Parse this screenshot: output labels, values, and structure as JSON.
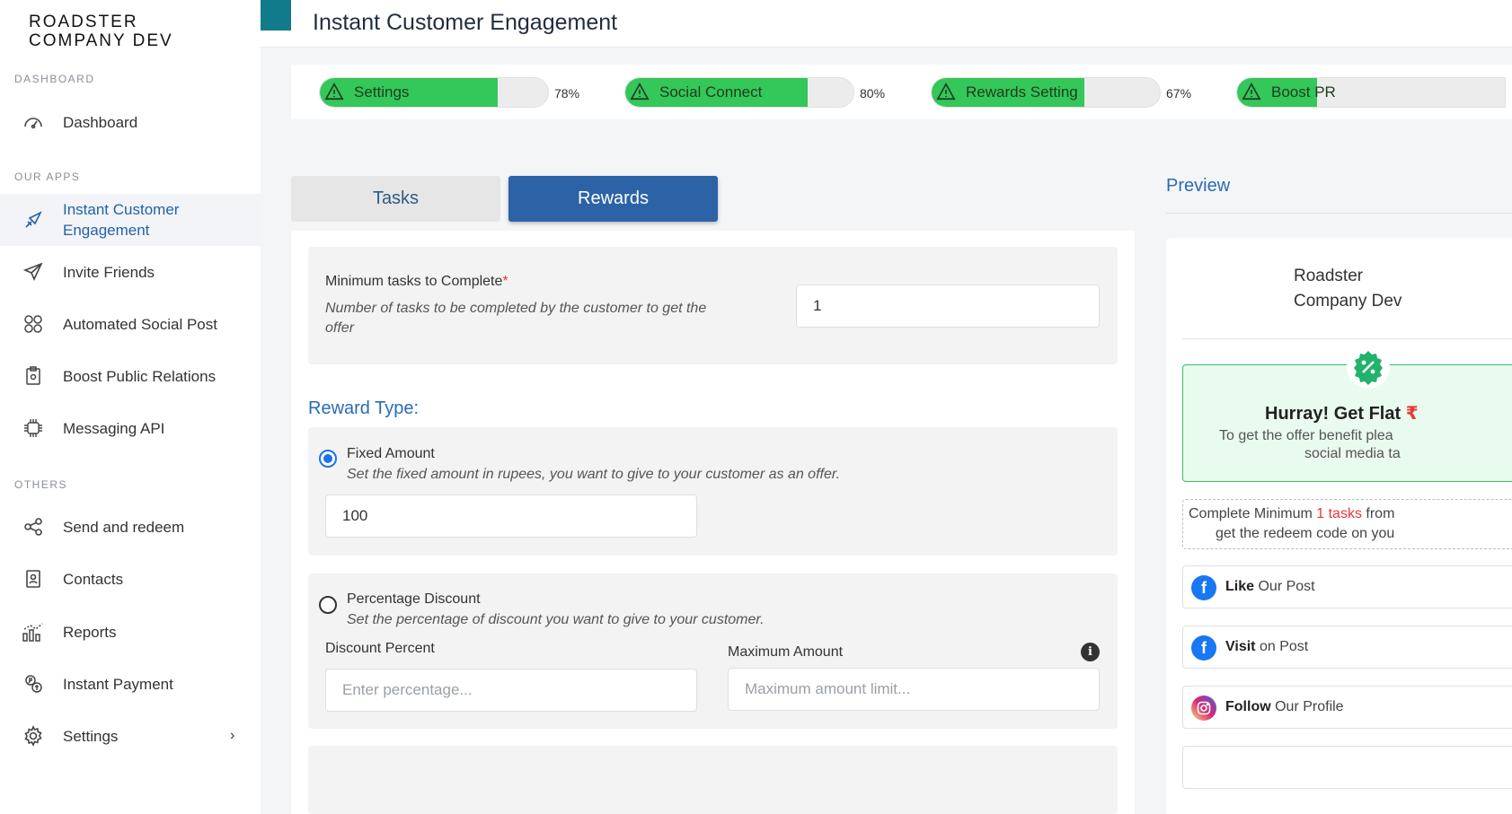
{
  "brand": {
    "line1": "ROADSTER",
    "line2": "COMPANY DEV"
  },
  "sidebar": {
    "sections": {
      "dashboard": "DASHBOARD",
      "apps": "OUR APPS",
      "others": "OTHERS"
    },
    "items": [
      {
        "label": "Dashboard",
        "icon": "gauge-icon"
      },
      {
        "label": "Instant Customer Engagement",
        "icon": "megaphone-icon",
        "active": true
      },
      {
        "label": "Invite Friends",
        "icon": "paper-plane-icon"
      },
      {
        "label": "Automated Social Post",
        "icon": "social-grid-icon"
      },
      {
        "label": "Boost Public Relations",
        "icon": "clipboard-icon"
      },
      {
        "label": "Messaging API",
        "icon": "api-chip-icon"
      },
      {
        "label": "Send and redeem",
        "icon": "share-icon"
      },
      {
        "label": "Contacts",
        "icon": "contact-book-icon"
      },
      {
        "label": "Reports",
        "icon": "bar-chart-icon"
      },
      {
        "label": "Instant Payment",
        "icon": "payment-icon"
      },
      {
        "label": "Settings",
        "icon": "gear-icon"
      }
    ]
  },
  "header": {
    "title": "Instant Customer Engagement"
  },
  "progress": [
    {
      "label": "Settings",
      "percent_text": "78%",
      "value": 78
    },
    {
      "label": "Social Connect",
      "percent_text": "80%",
      "value": 80
    },
    {
      "label": "Rewards Setting",
      "percent_text": "67%",
      "value": 67
    },
    {
      "label": "Boost PR",
      "percent_text": "",
      "value": 30
    }
  ],
  "tabs": {
    "tasks": "Tasks",
    "rewards": "Rewards"
  },
  "form": {
    "min_tasks_label": "Minimum tasks to Complete",
    "required_mark": "*",
    "min_tasks_hint_1": "Number of tasks to be completed by the customer to get the",
    "min_tasks_hint_2": "offer",
    "min_tasks_value": "1",
    "reward_type_label": "Reward Type:",
    "fixed": {
      "label": "Fixed Amount",
      "hint": "Set the fixed amount in rupees, you want to give to your customer as an offer.",
      "value": "100"
    },
    "percentage": {
      "label": "Percentage Discount",
      "hint": "Set the percentage of discount you want to give to your customer.",
      "discount_label": "Discount Percent",
      "discount_placeholder": "Enter percentage...",
      "max_label": "Maximum Amount",
      "max_placeholder": "Maximum amount limit..."
    }
  },
  "preview": {
    "title": "Preview",
    "company_1": "Roadster",
    "company_2": "Company Dev",
    "offer_title": "Hurray! Get Flat",
    "offer_currency": "₹",
    "offer_sub_1": "To get the offer benefit plea",
    "offer_sub_2": "social media ta",
    "min_1a": "Complete Minimum",
    "min_1b": "1 tasks",
    "min_1c": "from",
    "min_2": "get the redeem code on you",
    "tasks": [
      {
        "action": "Like",
        "rest": "Our Post",
        "icon": "facebook-icon",
        "color": "#1877f2"
      },
      {
        "action": "Visit",
        "rest": "on Post",
        "icon": "facebook-icon",
        "color": "#1877f2"
      },
      {
        "action": "Follow",
        "rest": "Our Profile",
        "icon": "instagram-icon",
        "color": "#d6249f"
      }
    ]
  },
  "colors": {
    "accent": "#2c63a7",
    "progress_fill": "#34c759",
    "header_accent": "#117a8b"
  }
}
